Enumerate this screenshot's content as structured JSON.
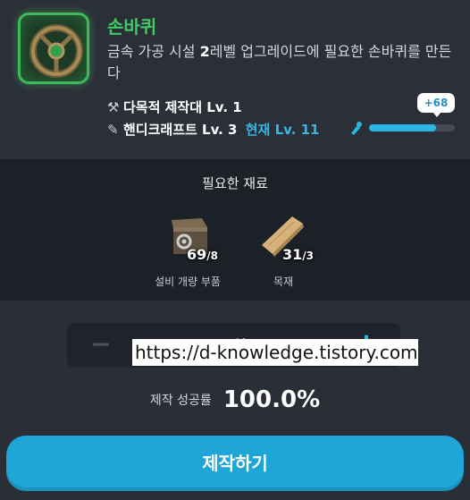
{
  "item": {
    "name": "손바퀴",
    "description_pre": "금속 가공 시설 ",
    "description_bold": "2",
    "description_post": "레벨 업그레이드에 필요한 손바퀴를 만든다"
  },
  "requirements": [
    {
      "icon": "workbench-icon",
      "text": "다목적 제작대 Lv. 1"
    },
    {
      "icon": "handcraft-icon",
      "text": "핸디크래프트 Lv. 3",
      "current_label": "현재",
      "current_value": "Lv. 11"
    }
  ],
  "xp": {
    "badge": "+68",
    "progress_percent": 78,
    "color": "#29b8e6"
  },
  "materials": {
    "title": "필요한 재료",
    "items": [
      {
        "icon": "equipment-parts-box-icon",
        "owned": "69",
        "required": "/8",
        "label": "설비 개량 부품"
      },
      {
        "icon": "wood-plank-icon",
        "owned": "31",
        "required": "/3",
        "label": "목재"
      }
    ]
  },
  "quantity": {
    "minus": "−",
    "value": "1회",
    "plus": "+"
  },
  "watermark": "https://d-knowledge.tistory.com",
  "success": {
    "label": "제작 성공률",
    "value": "100.0%"
  },
  "craft_button": "제작하기",
  "colors": {
    "accent": "#1fa6d6",
    "item_green": "#41c968",
    "current_blue": "#36b6e3"
  }
}
